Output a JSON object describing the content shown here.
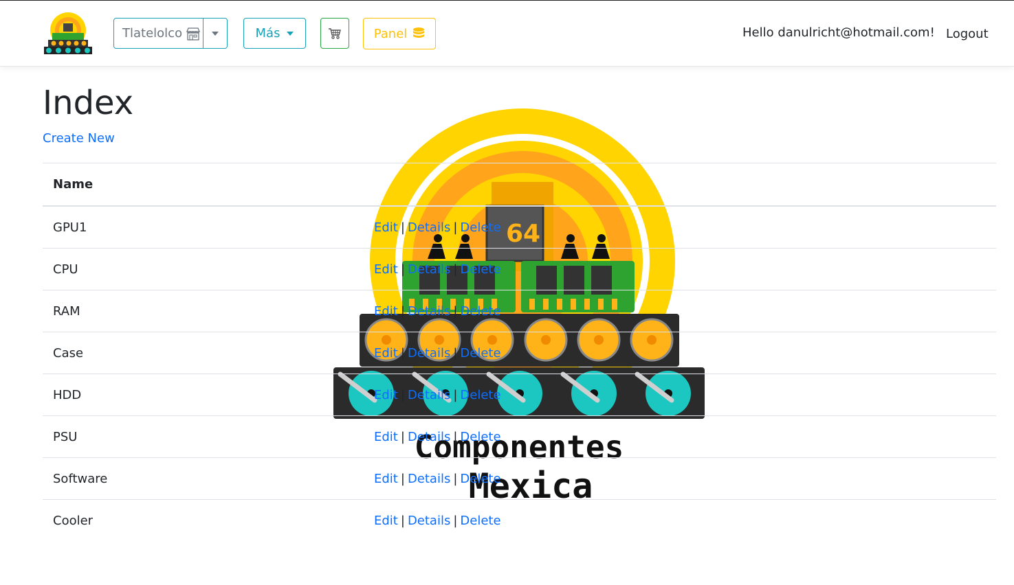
{
  "header": {
    "store_label": "Tlatelolco",
    "mas_label": "Más",
    "panel_label": "Panel",
    "hello_text": "Hello danulricht@hotmail.com!",
    "logout_label": "Logout"
  },
  "main": {
    "title": "Index",
    "create_label": "Create New",
    "column_name": "Name",
    "action_edit": "Edit",
    "action_details": "Details",
    "action_delete": "Delete",
    "separator": "|",
    "rows": [
      {
        "name": "GPU1"
      },
      {
        "name": "CPU"
      },
      {
        "name": "RAM"
      },
      {
        "name": "Case"
      },
      {
        "name": "HDD"
      },
      {
        "name": "PSU"
      },
      {
        "name": "Software"
      },
      {
        "name": "Cooler"
      }
    ]
  },
  "logo": {
    "chip_text": "64",
    "line1": "Componentes",
    "line2": "Mexica"
  },
  "colors": {
    "info": "#17a2b8",
    "success": "#28a745",
    "warning": "#ffc107",
    "link": "#0d6efd"
  }
}
